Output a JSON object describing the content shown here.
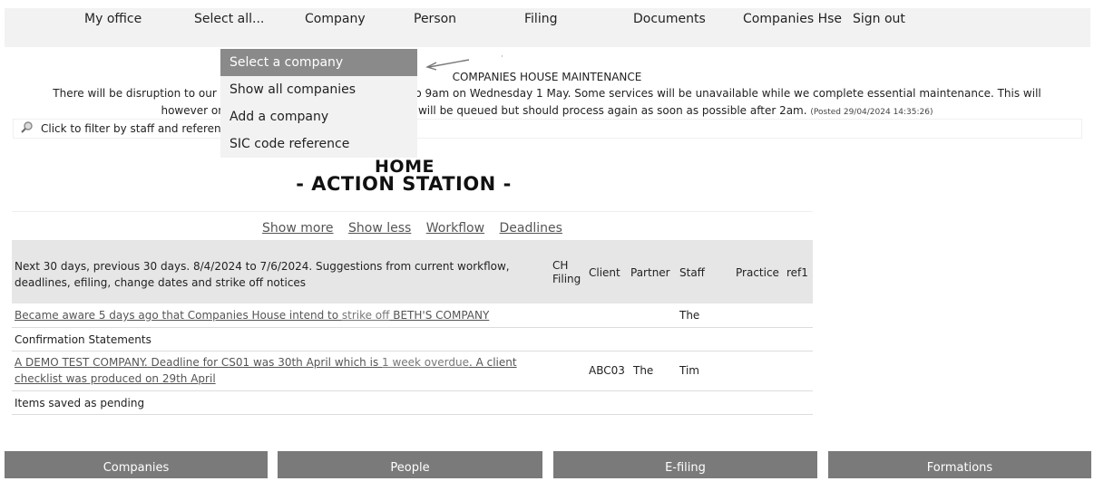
{
  "nav": {
    "items": [
      "My office",
      "Select all...",
      "Company",
      "Person",
      "Filing",
      "Documents",
      "Companies Hse",
      "Sign out"
    ]
  },
  "dropdown": {
    "items": [
      "Select a company",
      "Show all companies",
      "Add a company",
      "SIC code reference"
    ]
  },
  "notice": {
    "title": "COMPANIES HOUSE MAINTENANCE",
    "line1_left": "There will be disruption to our onl",
    "line1_right": ") April to 9am on Wednesday 1 May. Some services will be unavailable while we complete essential maintenance. This will",
    "line2_left": "however only a",
    "line2_right": "filings will be queued but should process again as soon as possible after 2am.",
    "posted": "(Posted 29/04/2024 14:35:26)"
  },
  "filter": {
    "text": "Click to filter by staff and referenc"
  },
  "headings": {
    "home": "HOME",
    "action": "- ACTION STATION -"
  },
  "table": {
    "links": [
      "Show more",
      "Show less",
      "Workflow",
      "Deadlines"
    ],
    "header_desc": "Next 30 days, previous 30 days. 8/4/2024 to 7/6/2024. Suggestions from current workflow, deadlines, efiling, change dates and strike off notices",
    "headers": {
      "ch_filing_1": "CH",
      "ch_filing_2": "Filing",
      "client": "Client",
      "partner": "Partner",
      "staff": "Staff",
      "practice": "Practice",
      "ref1": "ref1"
    },
    "rows": [
      {
        "text_a": "Became aware 5 days ago that Companies House intend to ",
        "text_b": "strike off",
        "text_c": " BETH'S COMPANY",
        "staff": "The"
      },
      {
        "section": "Confirmation Statements"
      },
      {
        "text_a": "A DEMO TEST COMPANY.",
        "text_b": " Deadline for CS01 was 30th April which is ",
        "text_c": "1 week overdue",
        "text_d": ". A client",
        "text_e": "checklist was produced on 29th April",
        "client": "ABC03",
        "partner": "The",
        "staff": "Tim"
      },
      {
        "section": "Items saved as pending"
      }
    ]
  },
  "tiles": [
    "Companies",
    "People",
    "E-filing",
    "Formations"
  ],
  "colors": {
    "active_menu": "#8a8a8a",
    "tile": "#7a7a7a",
    "nav_bg": "#f2f2f2",
    "header_bg": "#e6e6e6"
  }
}
